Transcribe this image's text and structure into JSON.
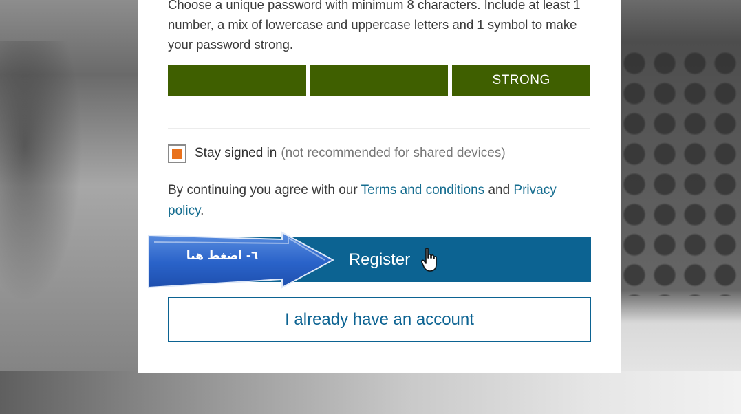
{
  "password_hint": "Choose a unique password with minimum 8 characters. Include at least 1 number, a mix of lowercase and uppercase letters and 1 symbol to make your password strong.",
  "strength_meter": {
    "segments": [
      "",
      "",
      "STRONG"
    ],
    "level": "STRONG",
    "filled_segments": 3,
    "total_segments": 3,
    "color": "#3f5f00"
  },
  "stay_signed_in": {
    "label": "Stay signed in",
    "note": "(not recommended for shared devices)",
    "checked": true,
    "check_color": "#e9711c"
  },
  "agreement": {
    "prefix": "By continuing you agree with our",
    "terms_link": "Terms and conditions",
    "and": "and",
    "privacy_link": "Privacy policy",
    "suffix": "."
  },
  "buttons": {
    "register": "Register",
    "existing_account": "I already have an account",
    "primary_color": "#0c6392"
  },
  "annotation": {
    "arrow_text": "٦- اضغط هنا",
    "arrow_color": "#2a63c9"
  },
  "icons": {
    "pointer": "hand-pointer-icon",
    "arrow": "arrow-right-icon"
  }
}
